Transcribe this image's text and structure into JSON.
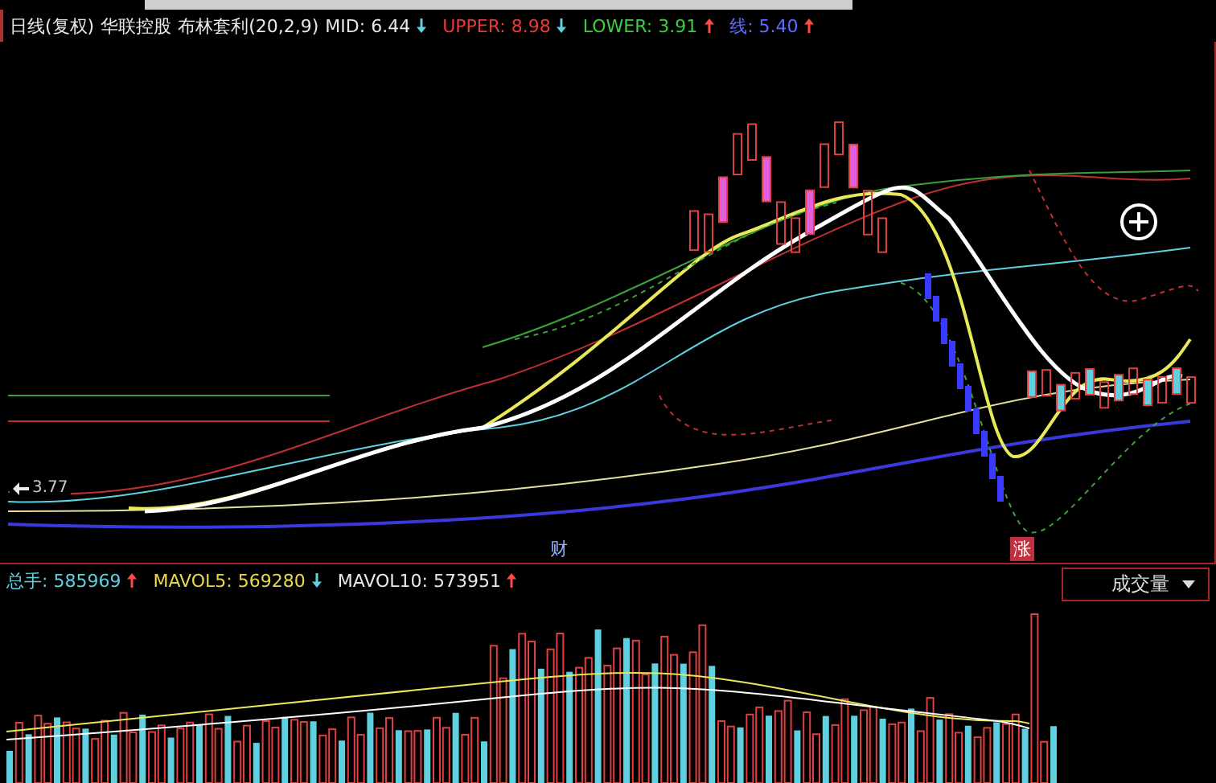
{
  "header": {
    "period": "日线(复权)",
    "stock": "华联控股",
    "indicator": "布林套利(20,2,9)",
    "readings": [
      {
        "label": "MID:",
        "value": "6.44",
        "rising": false,
        "color": "#e8e8e8"
      },
      {
        "label": "UPPER:",
        "value": "8.98",
        "rising": false,
        "color": "#e83a3a"
      },
      {
        "label": "LOWER:",
        "value": "3.91",
        "rising": true,
        "color": "#3ccf3c"
      },
      {
        "label": "线:",
        "value": "5.40",
        "rising": true,
        "color": "#5a6cff"
      }
    ]
  },
  "price_chart": {
    "low_marker": "3.77",
    "events": [
      {
        "kind": "finance",
        "label": "财"
      },
      {
        "kind": "limit",
        "label": "涨"
      }
    ]
  },
  "volume": {
    "readings": [
      {
        "label": "总手:",
        "value": "585969",
        "rising": true,
        "color": "#5fd0e0"
      },
      {
        "label": "MAVOL5:",
        "value": "569280",
        "rising": false,
        "color": "#e8d84a"
      },
      {
        "label": "MAVOL10:",
        "value": "573951",
        "rising": true,
        "color": "#e8e8e8"
      }
    ],
    "indicator_select": "成交量"
  }
}
